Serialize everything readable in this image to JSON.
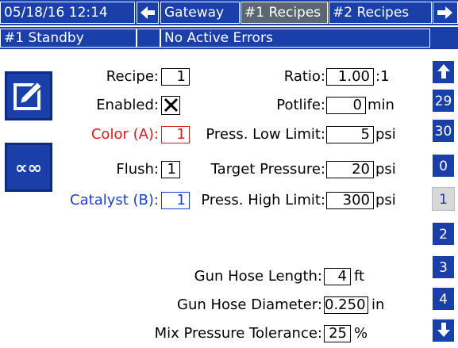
{
  "header": {
    "datetime": "05/18/16 12:14",
    "tabs": [
      {
        "label": "Gateway",
        "active": false
      },
      {
        "label": "#1 Recipes",
        "active": true
      },
      {
        "label": "#2 Recipes",
        "active": false
      }
    ]
  },
  "status": {
    "standby": "#1 Standby",
    "errors": "No Active Errors"
  },
  "fields": {
    "recipe": {
      "label": "Recipe:",
      "value": "1"
    },
    "enabled": {
      "label": "Enabled:",
      "checked": true
    },
    "color_a": {
      "label": "Color (A):",
      "value": "1"
    },
    "flush": {
      "label": "Flush:",
      "value": "1"
    },
    "catalyst_b": {
      "label": "Catalyst (B):",
      "value": "1"
    },
    "ratio": {
      "label": "Ratio:",
      "value": "1.00",
      "unit": ":1"
    },
    "potlife": {
      "label": "Potlife:",
      "value": "0",
      "unit": "min"
    },
    "press_low": {
      "label": "Press. Low Limit:",
      "value": "5",
      "unit": "psi"
    },
    "target_pressure": {
      "label": "Target Pressure:",
      "value": "20",
      "unit": "psi"
    },
    "press_high": {
      "label": "Press. High Limit:",
      "value": "300",
      "unit": "psi"
    },
    "gun_hose_length": {
      "label": "Gun Hose Length:",
      "value": "4",
      "unit": "ft"
    },
    "gun_hose_diameter": {
      "label": "Gun Hose Diameter:",
      "value": "0.250",
      "unit": "in"
    },
    "mix_pressure_tolerance": {
      "label": "Mix Pressure Tolerance:",
      "value": "25",
      "unit": "%"
    }
  },
  "sidebar": {
    "items": [
      "29",
      "30",
      "0",
      "1",
      "2",
      "3",
      "4"
    ],
    "selected": "1"
  },
  "colors": {
    "primary_blue": "#1a3fa8",
    "active_tab": "#5a6670",
    "red": "#e01818",
    "catalyst_blue": "#1a3fd0"
  },
  "icons": {
    "edit": "edit-icon",
    "infinity": "infinity-icon",
    "left_arrow": "arrow-left-icon",
    "right_arrow": "arrow-right-icon",
    "up_arrow": "arrow-up-icon",
    "down_arrow": "arrow-down-icon"
  }
}
